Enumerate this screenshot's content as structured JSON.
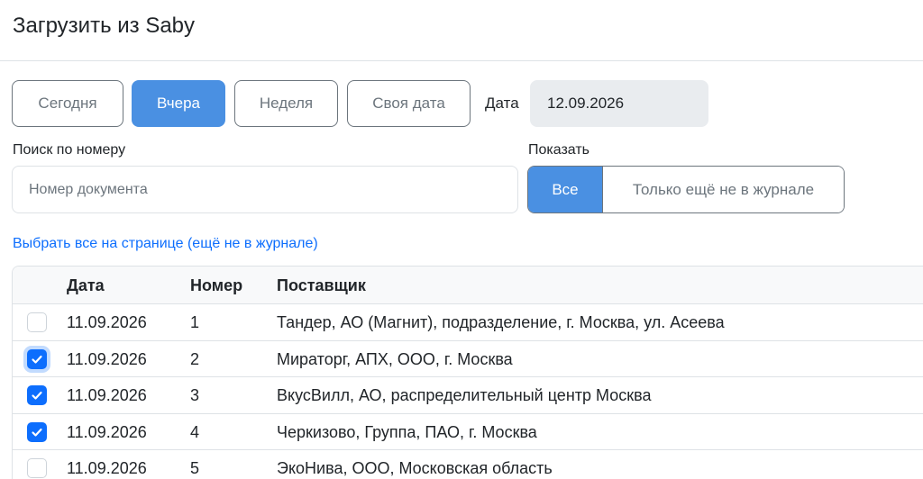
{
  "header": {
    "title": "Загрузить из Saby"
  },
  "range_buttons": [
    {
      "label": "Сегодня",
      "active": false
    },
    {
      "label": "Вчера",
      "active": true
    },
    {
      "label": "Неделя",
      "active": false
    },
    {
      "label": "Своя дата",
      "active": false
    }
  ],
  "date": {
    "label": "Дата",
    "value": "12.09.2026"
  },
  "search": {
    "label": "Поиск по номеру",
    "placeholder": "Номер документа"
  },
  "show": {
    "label": "Показать",
    "options": [
      {
        "label": "Все",
        "active": true
      },
      {
        "label": "Только ещё не в журнале",
        "active": false
      }
    ]
  },
  "select_all_link": "Выбрать все на странице (ещё не в журнале)",
  "table": {
    "columns": [
      "Дата",
      "Номер",
      "Поставщик"
    ],
    "rows": [
      {
        "checked": false,
        "date": "11.09.2026",
        "number": "1",
        "supplier": "Тандер, АО (Магнит), подразделение, г. Москва, ул. Асеева"
      },
      {
        "checked": true,
        "date": "11.09.2026",
        "number": "2",
        "supplier": "Мираторг, АПХ, ООО, г. Москва"
      },
      {
        "checked": true,
        "date": "11.09.2026",
        "number": "3",
        "supplier": "ВкусВилл, АО, распределительный центр Москва"
      },
      {
        "checked": true,
        "date": "11.09.2026",
        "number": "4",
        "supplier": "Черкизово, Группа, ПАО, г. Москва"
      },
      {
        "checked": false,
        "date": "11.09.2026",
        "number": "5",
        "supplier": "ЭкоНива, ООО, Московская область"
      }
    ]
  },
  "colors": {
    "accent": "#4a90e2",
    "checkbox": "#0d6efd",
    "link": "#0d6efd"
  }
}
